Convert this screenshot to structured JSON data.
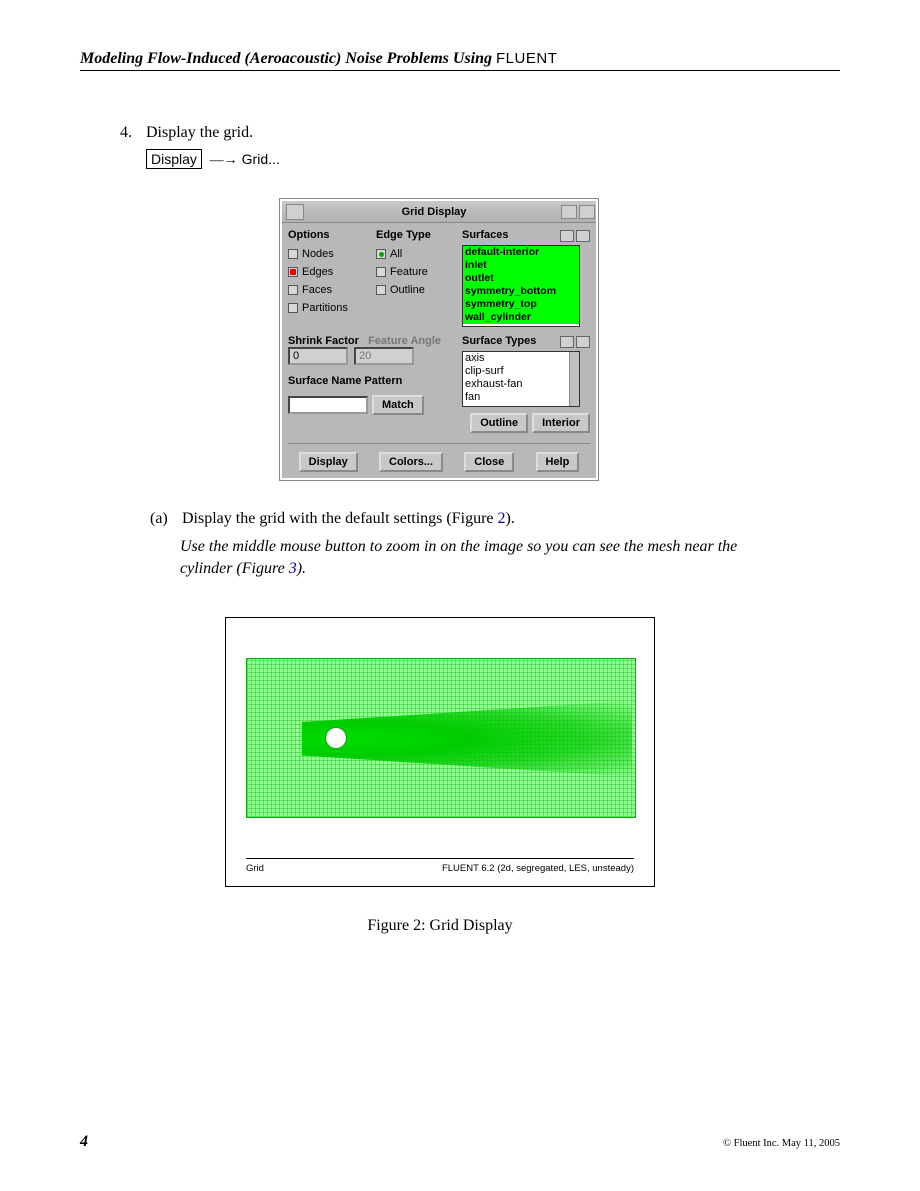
{
  "header": {
    "title_prefix": "Modeling Flow-Induced (Aeroacoustic) Noise Problems Using",
    "fluent": "FLUENT"
  },
  "step": {
    "number": "4.",
    "text": "Display the grid.",
    "menu_box": "Display",
    "arrow": "—→",
    "menu_item": "Grid..."
  },
  "dialog": {
    "title": "Grid Display",
    "options_label": "Options",
    "options": [
      {
        "label": "Nodes",
        "checked": false
      },
      {
        "label": "Edges",
        "checked": true
      },
      {
        "label": "Faces",
        "checked": false
      },
      {
        "label": "Partitions",
        "checked": false
      }
    ],
    "edge_type_label": "Edge Type",
    "edge_types": [
      {
        "label": "All",
        "selected": true
      },
      {
        "label": "Feature",
        "selected": false
      },
      {
        "label": "Outline",
        "selected": false
      }
    ],
    "surfaces_label": "Surfaces",
    "surfaces": [
      "default-interior",
      "inlet",
      "outlet",
      "symmetry_bottom",
      "symmetry_top",
      "wall_cylinder"
    ],
    "shrink_label": "Shrink Factor",
    "shrink_value": "0",
    "feature_angle_label": "Feature Angle",
    "feature_angle_value": "20",
    "pattern_label": "Surface Name Pattern",
    "match_btn": "Match",
    "surface_types_label": "Surface Types",
    "surface_types": [
      "axis",
      "clip-surf",
      "exhaust-fan",
      "fan"
    ],
    "outline_btn": "Outline",
    "interior_btn": "Interior",
    "bottom": {
      "display": "Display",
      "colors": "Colors...",
      "close": "Close",
      "help": "Help"
    }
  },
  "substep": {
    "letter": "(a)",
    "text_before": "Display the grid with the default settings (Figure ",
    "fig_link": "2",
    "text_after": ")."
  },
  "instruction": {
    "text_before": "Use the middle mouse button to zoom in on the image so you can see the mesh near the cylinder (Figure ",
    "fig_link": "3",
    "text_after": ")."
  },
  "figure": {
    "plot_label": "Grid",
    "version_line": "FLUENT 6.2 (2d, segregated, LES, unsteady)",
    "caption": "Figure 2: Grid Display"
  },
  "footer": {
    "page": "4",
    "copyright": "© Fluent Inc. May 11, 2005"
  }
}
